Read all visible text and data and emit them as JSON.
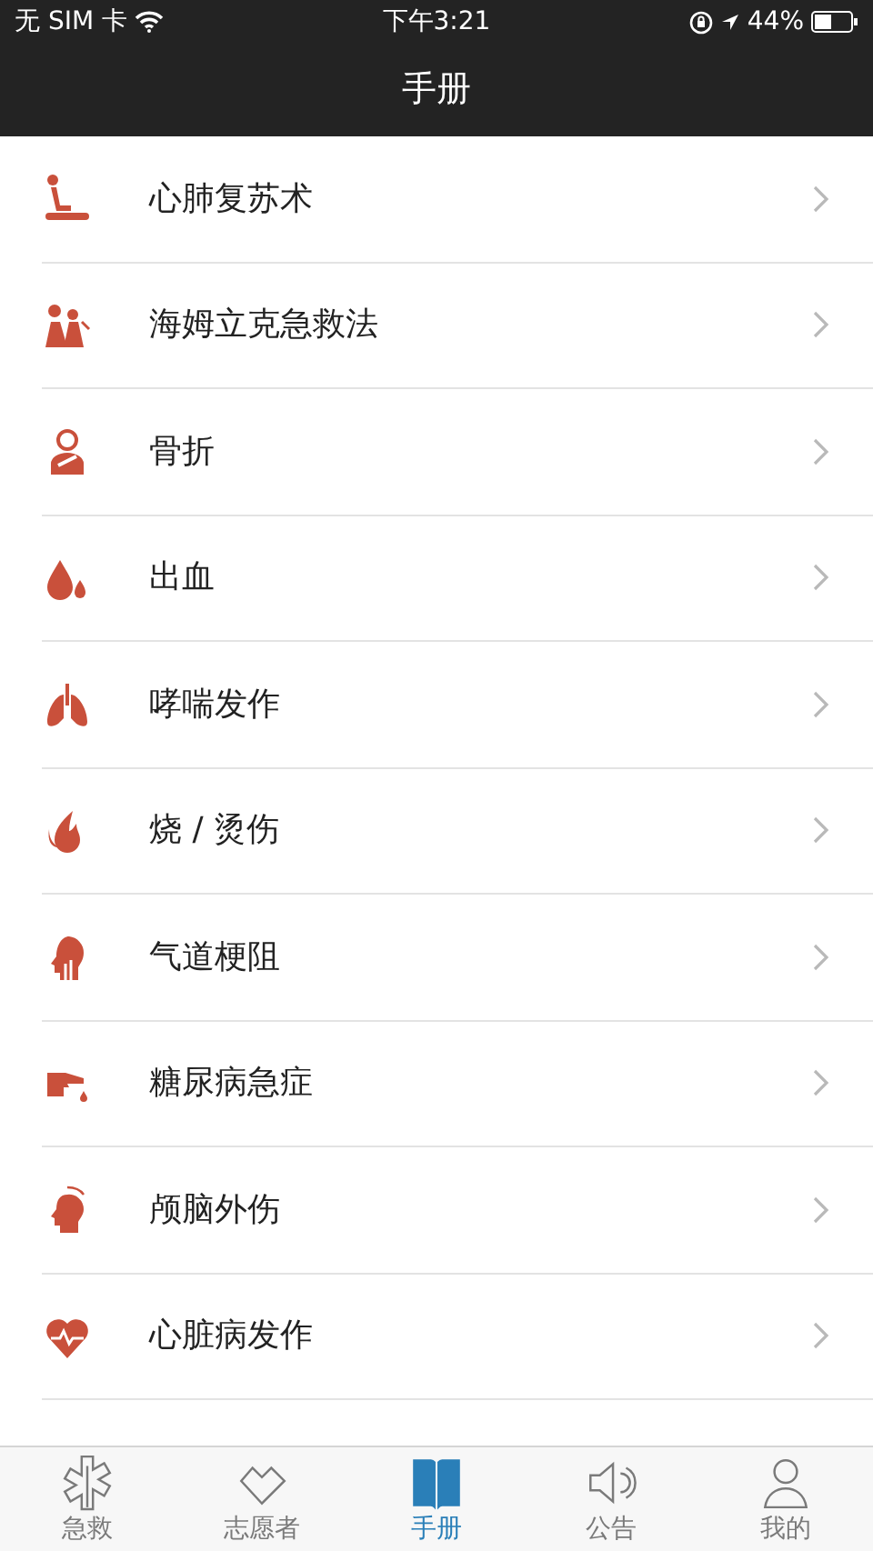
{
  "status_bar": {
    "carrier": "无 SIM 卡",
    "time": "下午3:21",
    "battery": "44%"
  },
  "nav_bar": {
    "title": "手册"
  },
  "items": [
    {
      "kind": "cpr",
      "label": "心肺复苏术"
    },
    {
      "kind": "heimlich",
      "label": "海姆立克急救法"
    },
    {
      "kind": "fracture",
      "label": "骨折"
    },
    {
      "kind": "bleeding",
      "label": "出血"
    },
    {
      "kind": "asthma",
      "label": "哮喘发作"
    },
    {
      "kind": "burn",
      "label": "烧 / 烫伤"
    },
    {
      "kind": "airway",
      "label": "气道梗阻"
    },
    {
      "kind": "diabetes",
      "label": "糖尿病急症"
    },
    {
      "kind": "head",
      "label": "颅脑外伤"
    },
    {
      "kind": "heart",
      "label": "心脏病发作"
    }
  ],
  "tab_bar": [
    {
      "kind": "aid",
      "label": "急救",
      "selected": false
    },
    {
      "kind": "volunteer",
      "label": "志愿者",
      "selected": false
    },
    {
      "kind": "book",
      "label": "手册",
      "selected": true
    },
    {
      "kind": "notice",
      "label": "公告",
      "selected": false
    },
    {
      "kind": "me",
      "label": "我的",
      "selected": false
    }
  ]
}
